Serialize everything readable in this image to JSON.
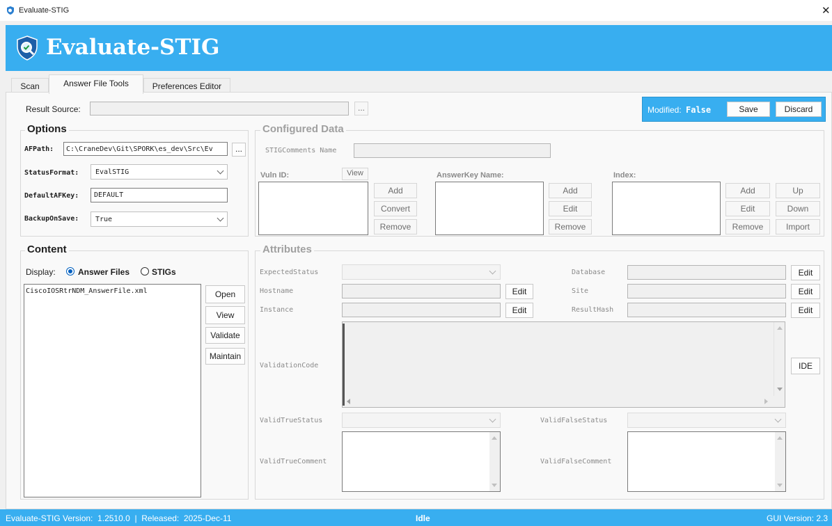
{
  "window": {
    "title": "Evaluate-STIG",
    "close_glyph": "✕"
  },
  "banner": {
    "title": "Evaluate-STIG",
    "logo_icon": "shield-magnifier-icon"
  },
  "tabs": [
    {
      "label": "Scan",
      "active": false
    },
    {
      "label": "Answer File Tools",
      "active": true
    },
    {
      "label": "Preferences Editor",
      "active": false
    }
  ],
  "result_source": {
    "label": "Result Source:",
    "value": "",
    "browse_label": "..."
  },
  "modified": {
    "label": "Modified:",
    "value": "False",
    "save_label": "Save",
    "discard_label": "Discard"
  },
  "options": {
    "title": "Options",
    "afpath_label": "AFPath:",
    "afpath_value": "C:\\CraneDev\\Git\\SPORK\\es_dev\\Src\\Ev",
    "afpath_browse": "...",
    "status_format_label": "StatusFormat:",
    "status_format_value": "EvalSTIG",
    "default_afkey_label": "DefaultAFKey:",
    "default_afkey_value": "DEFAULT",
    "backup_on_save_label": "BackupOnSave:",
    "backup_on_save_value": "True"
  },
  "configured_data": {
    "title": "Configured Data",
    "stig_comments_label": "STIGComments Name",
    "stig_comments_value": "",
    "vuln_id_label": "Vuln ID:",
    "view_label": "View",
    "vuln_buttons": [
      "Add",
      "Convert",
      "Remove"
    ],
    "answerkey_label": "AnswerKey Name:",
    "answerkey_buttons": [
      "Add",
      "Edit",
      "Remove"
    ],
    "index_label": "Index:",
    "index_buttons_left": [
      "Add",
      "Edit",
      "Remove"
    ],
    "index_buttons_right": [
      "Up",
      "Down",
      "Import"
    ]
  },
  "content": {
    "title": "Content",
    "display_label": "Display:",
    "radio_answer_files": "Answer Files",
    "radio_stigs": "STIGs",
    "selected": "Answer Files",
    "files": [
      "CiscoIOSRtrNDM_AnswerFile.xml"
    ],
    "buttons": [
      "Open",
      "View",
      "Validate",
      "Maintain"
    ]
  },
  "attributes": {
    "title": "Attributes",
    "expected_status_label": "ExpectedStatus",
    "hostname_label": "Hostname",
    "instance_label": "Instance",
    "database_label": "Database",
    "site_label": "Site",
    "result_hash_label": "ResultHash",
    "edit_label": "Edit",
    "validation_code_label": "ValidationCode",
    "ide_label": "IDE",
    "valid_true_status_label": "ValidTrueStatus",
    "valid_false_status_label": "ValidFalseStatus",
    "valid_true_comment_label": "ValidTrueComment",
    "valid_false_comment_label": "ValidFalseComment"
  },
  "statusbar": {
    "version_text": "Evaluate-STIG Version:  1.2510.0  |  Released:  2025-Dec-11",
    "state": "Idle",
    "gui_version": "GUI Version: 2.3"
  },
  "colors": {
    "accent": "#38aef0",
    "banner_text": "#ffffff"
  }
}
